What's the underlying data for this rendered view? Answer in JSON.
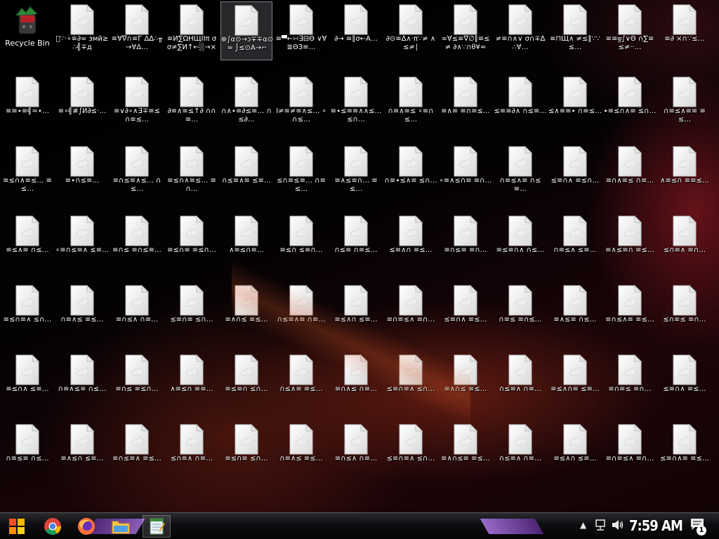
{
  "desktop": {
    "recycle_bin_label": "Recycle Bin",
    "selected_file_index": 3,
    "files": [
      "∵·∘͡≡∂∞ змй≥∴╣∓д",
      "≡∀∇∩≡Г Δ∆∴╥→∀Δ…",
      "≡И∑ΩΗЩΙΙπ σσ≠∑И↑←░→×",
      "⊕∫α⊙→ɔ∓∓α⊙≈ ⌡≤⊙А→⌐",
      "≡▀←∺∃⊟Θ ∨∀≣ΘЗ≡…",
      "∂→ ≡∥σ←А…",
      "∂⊙≡∆∧·π∵≠ ∧≤≠∣",
      "∞∀≤≡∇∅∥≡≤≠ ∂∧∵∩θ¥≈≤…",
      "≠≡∩∧∨ σ∩∓∆∴∀…",
      "≡⊓Щ∧ ≠≤∥∵∵≤…",
      "≡≡╦∫∨Θ ∩∑≡≤≠··…",
      "≡∂ ×∩∵≤…",
      "≡≡∙≡╣≈∙…",
      "≡∘╣≇∫И∂≤·…",
      "≡∨∂∘∧∃∓≡≤ ∩≡≤…",
      "∂≡∧≡≤↑∂ ∩∩≡…",
      "∩∧∙≡∂≤≡… ∩≤∂…",
      "Ι≠≡≠≡∧≤… ∘∩≤…",
      "≡∙≤≡≡∧∧≤… ≤∩…",
      "∩≡∧≡≤ ∘≡∩≤…",
      "≡∧≡ ≡∩≡≤…",
      "≤≡≡∂∧ ∩≤≡…",
      "≤∧≡≡∙ ∩≡≤…",
      "∙≡≤∩∧≡ ≤∩…",
      "∩≡≤∧≡≡ ≡≤…",
      "≡≤∩∧≡≤… ≡≤…",
      "≡∙∩≤≡…",
      "≡∩≤≡∧≤… ∩≤…",
      "≡≤∩∧≡≤… ≡∩…",
      "∩≤≡∧≡ ≤≡…",
      "≤∩≡≤≡… ∩≡≤…",
      "≡∧≤≡∩… ≡≤…",
      "∩≡∙≤∧≡ ≤∩…",
      "∘≡∧≤∩≡ ≡∩…",
      "∩≡≤∧≡ ∩≤≡…",
      "≤≡∩∧ ≡≤∩…",
      "≡∩∧≡≤ ∩≡…",
      "∧≡≤∩ ≡≡≤…",
      "≡≤∧≡ ∩≤…",
      "∘≡∩≤≡∧ ≤≡…",
      "≡∩≤ ≡∩≤≡…",
      "≡≤∩≡ ≡≤∩…",
      "∧≡≤∩≡…",
      "≡≤∩ ≤≡∩…",
      "∩≤≡ ∩≡≤…",
      "≤≡∧∩ ≡≤…",
      "≡∩≤≡ ≡∩…",
      "≡≤≡∩∧ ∩≤…",
      "∩≡≤∧ ≤≡…",
      "≡∧≤≡∩ ≡≤…",
      "≤∩≡∧ ≡∩…",
      "≡≤∩≡∧ ≤∩…",
      "∩≡∧≤ ≡≤…",
      "≡∩≤∧ ∩≡…",
      "≤≡∩≡ ≤∩…",
      "≡∧∩≤ ≡≤…",
      "∩≤≡∧≡ ∩≡…",
      "≡≤∧∩ ≤≡…",
      "≡∩≡≤∧ ≡∩…",
      "≤≡∩∧ ≡≤…",
      "∩≡≤ ≡∩≤…",
      "≡∧≤≡ ∩≤…",
      "≡∩≤∧≡ ≡≤…",
      "≤∩≡≤ ≡∩…",
      "≡≤∩∧ ≤≡…",
      "∩≡∧≤≡ ∩≤…",
      "≡∩≤ ≡≤∩…",
      "∧≡≤∩ ≡≡…",
      "≡≤≡∩ ≤∩…",
      "∩≤∧≡ ≡≤…",
      "≡∩∧≤ ∩≡…",
      "≤≡∩≡∧ ≤∩…",
      "≡∧∩≤ ≡≤…",
      "∩≤≡∧ ∩≡…",
      "≡≤∧∩≡ ≤≡…",
      "≡∩≡≤ ≡∩…",
      "≤≡∩∧ ≡≤…",
      "∩≡≤≡ ∩≤…",
      "≡∧≤∩ ≤≡…",
      "≡∩≤≡∧ ≡≤…",
      "≤∩≡∧ ∩≡…",
      "≡≤∩≡ ≤∩…",
      "∩≡∧≤ ≡≤…",
      "≡∩≤∧ ∩≡…",
      "≤≡∩≡∧ ≤∩…",
      "≡∧∩≤≡ ≡≤…",
      "∩≤≡∧ ∩≡…",
      "≡≤∧∩ ≤≡…",
      "≡∩≡≤∧ ≡∩…",
      "≤≡∩∧≡ ≡≤…",
      "∩≡≤≡ ∩≤…"
    ]
  },
  "taskbar": {
    "clock": "7:59 AM",
    "action_center_badge": "1",
    "apps": [
      {
        "icon": "start-orb-icon"
      },
      {
        "icon": "chrome-icon"
      },
      {
        "icon": "firefox-icon"
      },
      {
        "icon": "file-explorer-icon"
      },
      {
        "icon": "notepad-icon"
      }
    ],
    "tray_icons": [
      "show-hidden-icons-icon",
      "network-icon",
      "volume-icon",
      "action-center-icon"
    ]
  },
  "colors": {
    "icon_label": "#ffffff",
    "taskbar_bg": "#0d0d10",
    "accent_purple": "#8a4fc4",
    "wallpaper_red": "#8c1a22"
  }
}
